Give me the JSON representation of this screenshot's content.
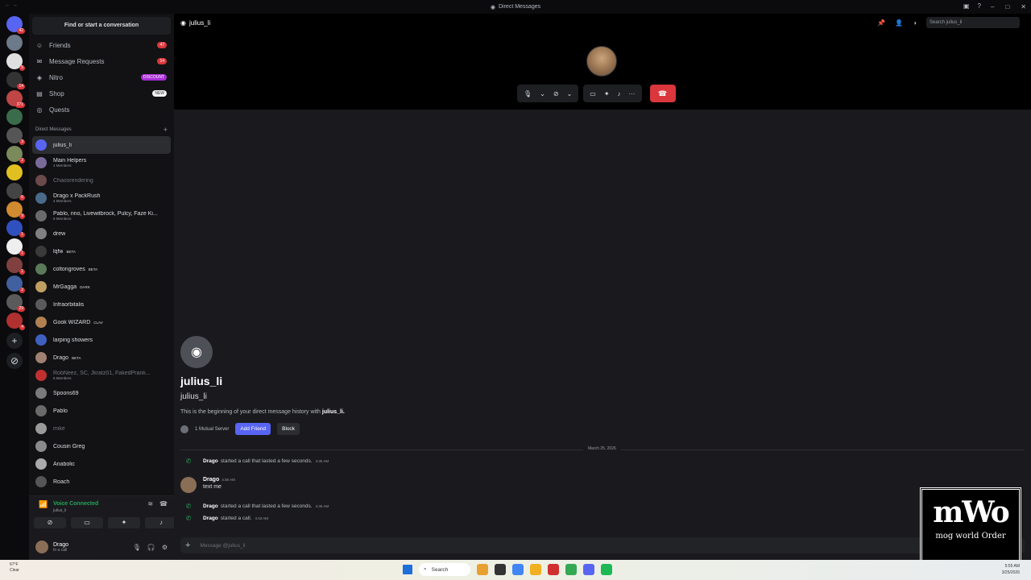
{
  "window": {
    "title": "Direct Messages"
  },
  "sidebar": {
    "find_placeholder": "Find or start a conversation",
    "nav": [
      {
        "label": "Friends",
        "icon": "friends-icon",
        "badge": "47"
      },
      {
        "label": "Message Requests",
        "icon": "envelope-icon",
        "badge": "14"
      },
      {
        "label": "Nitro",
        "icon": "nitro-icon",
        "badge": "DISCOUNT"
      },
      {
        "label": "Shop",
        "icon": "shop-icon",
        "badge": "NEW"
      },
      {
        "label": "Quests",
        "icon": "quests-icon",
        "badge": ""
      }
    ],
    "dm_header": "Direct Messages",
    "dms": [
      {
        "name": "julius_li",
        "sub": "",
        "tag": ""
      },
      {
        "name": "Main Helpers",
        "sub": "4 Members",
        "tag": ""
      },
      {
        "name": "Chaosrendering",
        "sub": "",
        "tag": ""
      },
      {
        "name": "Drago x PackRush",
        "sub": "4 Members",
        "tag": ""
      },
      {
        "name": "Pablo, rino, Livewitbrock, Pulcy, Faze Ki...",
        "sub": "8 Members",
        "tag": ""
      },
      {
        "name": "drew",
        "sub": "",
        "tag": ""
      },
      {
        "name": "lqfw",
        "sub": "",
        "tag": "BETA"
      },
      {
        "name": "coltongroves",
        "sub": "",
        "tag": "BETA"
      },
      {
        "name": "MrGagga",
        "sub": "",
        "tag": "DARK"
      },
      {
        "name": "Infraorbitalis",
        "sub": "",
        "tag": ""
      },
      {
        "name": "Gook WIZARD",
        "sub": "",
        "tag": "CLAV"
      },
      {
        "name": "larping showers",
        "sub": "",
        "tag": ""
      },
      {
        "name": "Drago",
        "sub": "",
        "tag": "BETA"
      },
      {
        "name": "RobNeez, SC, Jkratz01, FakedPrank...",
        "sub": "6 Members",
        "tag": ""
      },
      {
        "name": "Spoons69",
        "sub": "",
        "tag": ""
      },
      {
        "name": "Pablo",
        "sub": "",
        "tag": ""
      },
      {
        "name": "mike",
        "sub": "",
        "tag": ""
      },
      {
        "name": "Cousin Greg",
        "sub": "",
        "tag": ""
      },
      {
        "name": "Anabolic",
        "sub": "",
        "tag": ""
      },
      {
        "name": "Roach",
        "sub": "",
        "tag": ""
      }
    ],
    "voice": {
      "status": "Voice Connected",
      "channel": "julius_li"
    },
    "user": {
      "name": "Drago",
      "status": "In a call"
    }
  },
  "channel": {
    "name": "julius_li",
    "search_placeholder": "Search julius_li"
  },
  "intro": {
    "display_name": "julius_li",
    "username": "julius_li",
    "text_prefix": "This is the beginning of your direct message history with",
    "text_user": "julius_li.",
    "mutual": "1 Mutual Server",
    "add_friend": "Add Friend",
    "block": "Block"
  },
  "date_divider": "March 25, 2026",
  "messages": [
    {
      "type": "call",
      "author": "Drago",
      "text": "started a call that lasted a few seconds.",
      "time": "4:35 AM"
    },
    {
      "type": "chat",
      "author": "Drago",
      "text": "text me",
      "time": "4:36 AM"
    },
    {
      "type": "call",
      "author": "Drago",
      "text": "started a call that lasted a few seconds.",
      "time": "4:36 AM"
    },
    {
      "type": "call",
      "author": "Drago",
      "text": "started a call.",
      "time": "4:43 AM"
    }
  ],
  "composer": {
    "placeholder": "Message @julius_li"
  },
  "watermark": {
    "big": "mWo",
    "small": "mog world Order"
  },
  "taskbar": {
    "weather_temp": "67°F",
    "weather_desc": "Clear",
    "search": "Search",
    "time": "5:55 AM",
    "date": "3/25/2026"
  }
}
